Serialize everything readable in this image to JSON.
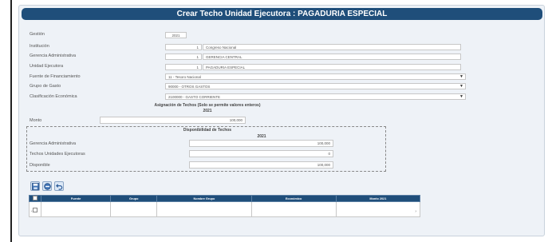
{
  "title": "Crear Techo Unidad Ejecutora : PAGADURIA ESPECIAL",
  "form": {
    "gestion": {
      "label": "Gestión",
      "value": "2021"
    },
    "institucion": {
      "label": "Institución",
      "code": "1",
      "name": "Congreso Nacional"
    },
    "gerencia": {
      "label": "Gerencia Administrativa",
      "code": "1",
      "name": "GERENCIA CENTRAL"
    },
    "unidad": {
      "label": "Unidad Ejecutora",
      "code": "1",
      "name": "PAGADURIA ESPECIAL"
    },
    "fuente": {
      "label": "Fuente de Financiamiento",
      "value": "11 - Tesoro Nacional"
    },
    "grupo": {
      "label": "Grupo de Gasto",
      "value": "90000 - OTROS GASTOS"
    },
    "clasificacion": {
      "label": "Clasificación Económica",
      "value": "2100000 - GASTO CORRIENTE"
    }
  },
  "asignacion": {
    "heading": "Asignación de Techos (Solo se permite valores enteros)",
    "year": "2021",
    "monto_label": "Monto",
    "monto_value": "100,000"
  },
  "disponibilidad": {
    "heading": "Disponibilidad de Techos",
    "year": "2021",
    "rows": [
      {
        "label": "Gerencia Administrativa",
        "value": "100,000"
      },
      {
        "label": "Techos Unidades Ejecutoras",
        "value": "0"
      },
      {
        "label": "Disponible",
        "value": "100,000"
      }
    ]
  },
  "toolbar": {
    "save_icon": "save-icon",
    "cancel_icon": "cancel-icon",
    "back_icon": "undo-icon"
  },
  "grid": {
    "columns": [
      "",
      "Fuente",
      "Grupo",
      "Nombre Grupo",
      "Económico",
      "Monto 2021"
    ]
  },
  "colors": {
    "header": "#1f4e7a",
    "panel": "#eef2f7"
  }
}
